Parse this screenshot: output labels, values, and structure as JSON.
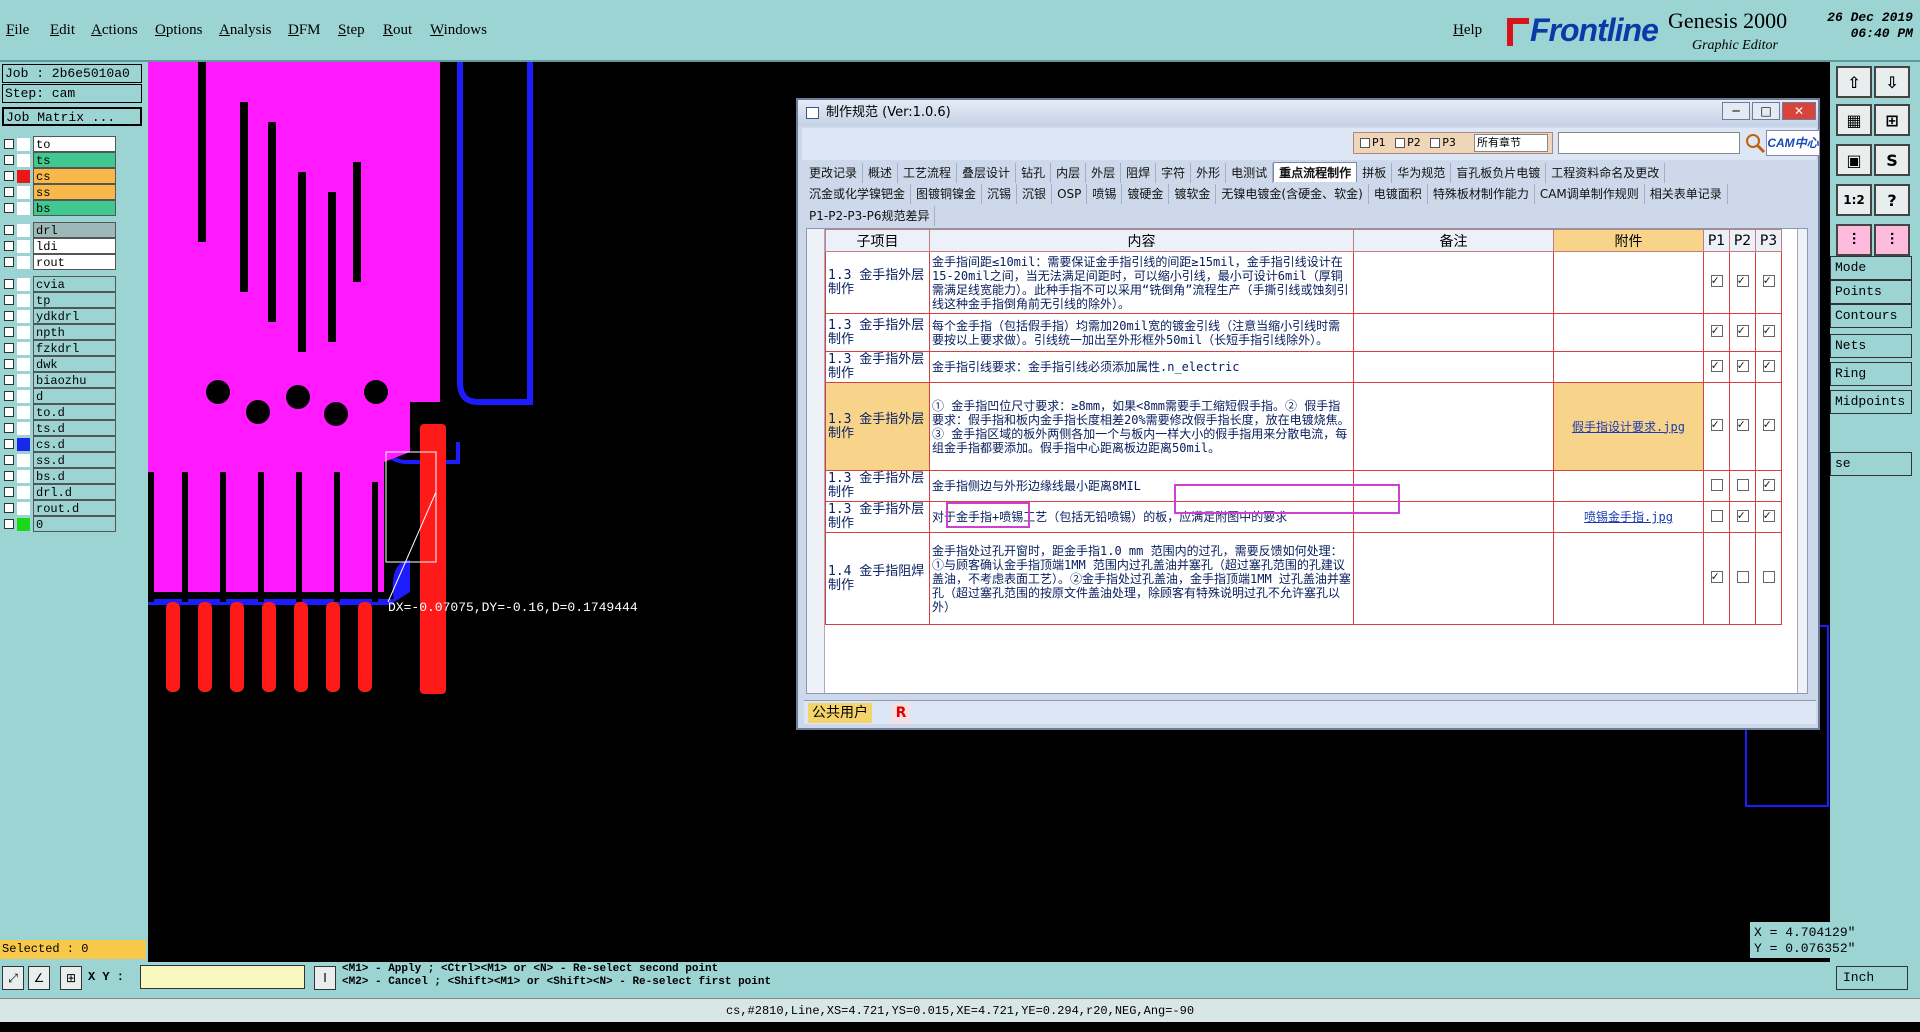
{
  "menu": {
    "items": [
      "File",
      "Edit",
      "Actions",
      "Options",
      "Analysis",
      "DFM",
      "Step",
      "Rout",
      "Windows"
    ],
    "help": "Help"
  },
  "brand": {
    "logo": "Frontline",
    "product": "Genesis 2000",
    "subtitle": "Graphic Editor",
    "date": "26 Dec 2019",
    "time": "06:40 PM"
  },
  "job": {
    "job": "Job : 2b6e5010a0",
    "step": "Step: cam",
    "matrix": "Job Matrix ..."
  },
  "layers": [
    {
      "name": "to",
      "color": "#ffffff",
      "swatch": "#ffffff"
    },
    {
      "name": "ts",
      "color": "#40c890",
      "swatch": "#ffffff"
    },
    {
      "name": "cs",
      "color": "#f8b84a",
      "swatch": "#e81818"
    },
    {
      "name": "ss",
      "color": "#f8b84a",
      "swatch": "#ffffff"
    },
    {
      "name": "bs",
      "color": "#40c890",
      "swatch": "#ffffff"
    },
    {
      "name": "drl",
      "color": "#9cb8b8",
      "swatch": "#ffffff"
    },
    {
      "name": "ldi",
      "color": "#ffffff",
      "swatch": "#ffffff"
    },
    {
      "name": "rout",
      "color": "#ffffff",
      "swatch": "#ffffff"
    },
    {
      "name": "cvia",
      "color": "#9cd3d3",
      "swatch": "#ffffff"
    },
    {
      "name": "tp",
      "color": "#9cd3d3",
      "swatch": "#ffffff"
    },
    {
      "name": "ydkdrl",
      "color": "#9cd3d3",
      "swatch": "#ffffff"
    },
    {
      "name": "npth",
      "color": "#9cd3d3",
      "swatch": "#ffffff"
    },
    {
      "name": "fzkdrl",
      "color": "#9cd3d3",
      "swatch": "#ffffff"
    },
    {
      "name": "dwk",
      "color": "#9cd3d3",
      "swatch": "#ffffff"
    },
    {
      "name": "biaozhu",
      "color": "#9cd3d3",
      "swatch": "#ffffff"
    },
    {
      "name": "d",
      "color": "#9cd3d3",
      "swatch": "#ffffff"
    },
    {
      "name": "to.d",
      "color": "#9cd3d3",
      "swatch": "#ffffff"
    },
    {
      "name": "ts.d",
      "color": "#9cd3d3",
      "swatch": "#ffffff"
    },
    {
      "name": "cs.d",
      "color": "#9cd3d3",
      "swatch": "#1828e8"
    },
    {
      "name": "ss.d",
      "color": "#9cd3d3",
      "swatch": "#ffffff"
    },
    {
      "name": "bs.d",
      "color": "#9cd3d3",
      "swatch": "#ffffff"
    },
    {
      "name": "drl.d",
      "color": "#9cd3d3",
      "swatch": "#ffffff"
    },
    {
      "name": "rout.d",
      "color": "#9cd3d3",
      "swatch": "#ffffff"
    },
    {
      "name": "0",
      "color": "#9cd3d3",
      "swatch": "#18d818"
    }
  ],
  "selected": "Selected : 0",
  "measure": "DX=-0.07075,DY=-0.16,D=0.1749444",
  "side_items": [
    "Mode",
    "Points",
    "Contours",
    "Nets",
    "Ring",
    "Midpoints",
    "se"
  ],
  "coords": {
    "x": "X = 4.704129\"",
    "y": "Y = 0.076352\""
  },
  "prompt": {
    "line1": "<M1> - Apply  ; <Ctrl><M1> or <N> - Re-select second point",
    "line2": "<M2> - Cancel ; <Shift><M1> or <Shift><N> - Re-select first point"
  },
  "xy_label": "X Y :",
  "units": "Inch",
  "status": "cs,#2810,Line,XS=4.721,YS=0.015,XE=4.721,YE=0.294,r20,NEG,Ang=-90",
  "dialog": {
    "title": "制作规范 (Ver:1.0.6)",
    "filter": {
      "p1": "P1",
      "p2": "P2",
      "p3": "P3",
      "chapter": "所有章节"
    },
    "cam_logo": "CAM中心",
    "tabs1": [
      "更改记录",
      "概述",
      "工艺流程",
      "叠层设计",
      "钻孔",
      "内层",
      "外层",
      "阻焊",
      "字符",
      "外形",
      "电测试",
      "重点流程制作",
      "拼板",
      "华为规范",
      "盲孔板负片电镀",
      "工程资料命名及更改"
    ],
    "tabs2": [
      "沉金或化学镍钯金",
      "图镀铜镍金",
      "沉锡",
      "沉银",
      "OSP",
      "喷锡",
      "镀硬金",
      "镀软金",
      "无镍电镀金(含硬金、软金)",
      "电镀面积",
      "特殊板材制作能力",
      "CAM调单制作规则",
      "相关表单记录"
    ],
    "tabs3": [
      "P1-P2-P3-P6规范差异"
    ],
    "headers": [
      "子项目",
      "内容",
      "备注",
      "附件",
      "P1",
      "P2",
      "P3"
    ],
    "rows": [
      {
        "sub": "1.3 金手指外层制作",
        "content": "金手指间距≤10mil：需要保证金手指引线的间距≥15mil，金手指引线设计在15-20mil之间，当无法满足间距时，可以缩小引线，最小可设计6mil（厚铜需满足线宽能力）。此种手指不可以采用“铣倒角”流程生产（手撕引线或蚀刻引线这种金手指倒角前无引线的除外）。",
        "note": "",
        "attach": "",
        "p": [
          true,
          true,
          true
        ]
      },
      {
        "sub": "1.3 金手指外层制作",
        "content": "每个金手指（包括假手指）均需加20mil宽的镀金引线（注意当缩小引线时需要按以上要求做）。引线统一加出至外形框外50mil（长短手指引线除外）。",
        "note": "",
        "attach": "",
        "p": [
          true,
          true,
          true
        ]
      },
      {
        "sub": "1.3 金手指外层制作",
        "content": "金手指引线要求：金手指引线必须添加属性.n_electric",
        "note": "",
        "attach": "",
        "p": [
          true,
          true,
          true
        ]
      },
      {
        "sub": "1.3 金手指外层制作",
        "content": "① 金手指凹位尺寸要求：≥8mm，如果<8mm需要手工缩短假手指。② 假手指要求：假手指和板内金手指长度相差20%需要修改假手指长度，放在电镀烧焦。③ 金手指区域的板外两侧各加一个与板内一样大小的假手指用来分散电流，每组金手指都要添加。假手指中心距离板边距离50mil。",
        "note": "",
        "attach": "假手指设计要求.jpg",
        "p": [
          true,
          true,
          true
        ],
        "hl": true
      },
      {
        "sub": "1.3 金手指外层制作",
        "content": "金手指侧边与外形边缘线最小距离8MIL",
        "note": "",
        "attach": "",
        "p": [
          false,
          false,
          true
        ]
      },
      {
        "sub": "1.3 金手指外层制作",
        "content": "对于金手指+喷锡工艺（包括无铅喷锡）的板，应满足附图中的要求",
        "note": "",
        "attach": "喷锡金手指.jpg",
        "p": [
          false,
          true,
          true
        ]
      },
      {
        "sub": "1.4 金手指阻焊制作",
        "content": "金手指处过孔开窗时，距金手指1.0 mm 范围内的过孔，需要反馈如何处理：①与顾客确认金手指顶端1MM 范围内过孔盖油并塞孔（超过塞孔范围的孔建议盖油，不考虑表面工艺）。②金手指处过孔盖油，金手指顶端1MM 过孔盖油并塞孔（超过塞孔范围的按原文件盖油处理，除顾客有特殊说明过孔不允许塞孔以外）",
        "note": "",
        "attach": "",
        "p": [
          true,
          false,
          false
        ]
      }
    ],
    "footer_user": "公共用户",
    "footer_r": "R"
  }
}
